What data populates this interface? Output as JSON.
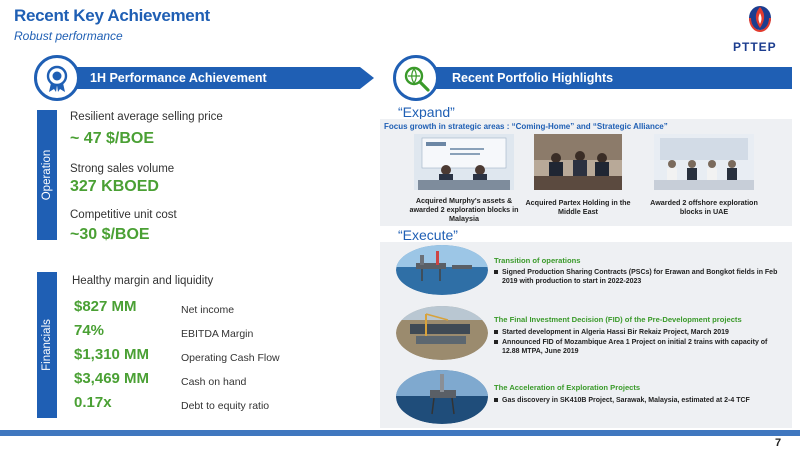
{
  "header": {
    "title": "Recent Key Achievement",
    "subtitle": "Robust performance",
    "logo_text": "PTTEP"
  },
  "left_panel": {
    "bar_label": "1H Performance Achievement",
    "operation_tab": "Operation",
    "financials_tab": "Financials",
    "operation": [
      {
        "label": "Resilient average selling price",
        "value": "~ 47 $/BOE"
      },
      {
        "label": "Strong sales volume",
        "value": "327 KBOED"
      },
      {
        "label": "Competitive unit cost",
        "value": "~30 $/BOE"
      }
    ],
    "financials_heading": "Healthy margin and liquidity",
    "financials": [
      {
        "value": "$827 MM",
        "label": "Net income"
      },
      {
        "value": "74%",
        "label": "EBITDA Margin"
      },
      {
        "value": "$1,310 MM",
        "label": "Operating Cash Flow"
      },
      {
        "value": "$3,469 MM",
        "label": "Cash on hand"
      },
      {
        "value": "0.17x",
        "label": "Debt to equity ratio"
      }
    ]
  },
  "right_panel": {
    "bar_label": "Recent Portfolio Highlights",
    "expand": {
      "heading": "“Expand”",
      "subheading": "Focus growth in strategic areas : “Coming-Home” and “Strategic Alliance”",
      "captions": [
        "Acquired Murphy's assets & awarded 2 exploration blocks in Malaysia",
        "Acquired Partex Holding in the Middle East",
        "Awarded 2 offshore exploration blocks in UAE"
      ]
    },
    "execute": {
      "heading": "“Execute”",
      "items": [
        {
          "title": "Transition of operations",
          "bullets": [
            "Signed Production Sharing Contracts (PSCs) for Erawan and Bongkot fields in Feb 2019 with production to start in 2022-2023"
          ]
        },
        {
          "title": "The Final Investment Decision (FID) of the Pre-Development projects",
          "bullets": [
            "Started development in Algeria Hassi Bir Rekaiz Project, March 2019",
            "Announced FID of Mozambique Area 1 Project on initial 2 trains with capacity of 12.88 MTPA, June 2019"
          ]
        },
        {
          "title": "The Acceleration of Exploration Projects",
          "bullets": [
            "Gas discovery in SK410B Project, Sarawak, Malaysia, estimated at 2-4 TCF"
          ]
        }
      ]
    }
  },
  "footer": {
    "page_number": "7"
  },
  "colors": {
    "primary_blue": "#1f5fb4",
    "accent_green": "#4aa034"
  }
}
